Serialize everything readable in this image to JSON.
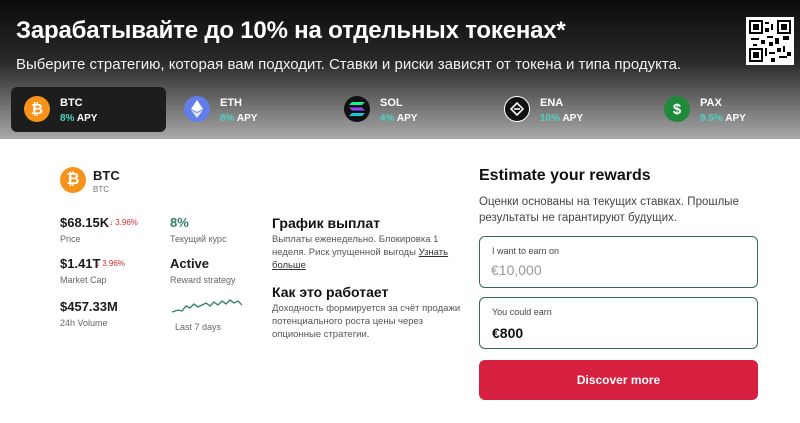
{
  "hero": {
    "title": "Зарабатывайте до 10% на отдельных токенах*",
    "subtitle": "Выберите стратегию, которая вам подходит. Ставки и риски зависят от токена и типа продукта."
  },
  "tabs": [
    {
      "name": "BTC",
      "apy_pct": "8%",
      "apy_label": "APY",
      "icon": "bitcoin-icon",
      "color": "#f7931a",
      "active": true
    },
    {
      "name": "ETH",
      "apy_pct": "8%",
      "apy_label": "APY",
      "icon": "ethereum-icon",
      "color": "#627eea",
      "active": false
    },
    {
      "name": "SOL",
      "apy_pct": "4%",
      "apy_label": "APY",
      "icon": "solana-icon",
      "color": "#111111",
      "active": false
    },
    {
      "name": "ENA",
      "apy_pct": "10%",
      "apy_label": "APY",
      "icon": "ethena-icon",
      "color": "#111111",
      "active": false
    },
    {
      "name": "PAX",
      "apy_pct": "9.5%",
      "apy_label": "APY",
      "icon": "paxos-icon",
      "color": "#1e8a3a",
      "active": false
    }
  ],
  "coin": {
    "name": "BTC",
    "symbol": "BTC",
    "price": "$68.15K",
    "price_change": "↓ 3.96%",
    "price_label": "Price",
    "market_cap": "$1.41T",
    "market_cap_change": "↓ 3.96%",
    "market_cap_label": "Market Cap",
    "volume": "$457.33M",
    "volume_label": "24h Volume",
    "rate": "8%",
    "rate_label": "Текущий курс",
    "strategy": "Active",
    "strategy_label": "Reward strategy",
    "spark_label": "Last 7 days"
  },
  "payout": {
    "title": "График выплат",
    "text": "Выплаты еженедельно. Блокировка 1 неделя. Риск упущенной выгоды",
    "link": "Узнать больше"
  },
  "how": {
    "title": "Как это работает",
    "text": "Доходность формируется за счёт продажи потенциального роста цены через опционные стратегии."
  },
  "estimate": {
    "title": "Estimate your rewards",
    "desc": "Оценки основаны на текущих ставках. Прошлые результаты не гарантируют будущих.",
    "earn_label": "I want to earn on",
    "earn_placeholder": "€10,000",
    "could_label": "You could earn",
    "could_value": "€800",
    "cta": "Discover more"
  },
  "colors": {
    "accent": "#d71f3f",
    "field_border": "#2f6b63",
    "apy": "#4fd1c5",
    "negative": "#d32f2f",
    "positive": "#2e7d6a"
  }
}
